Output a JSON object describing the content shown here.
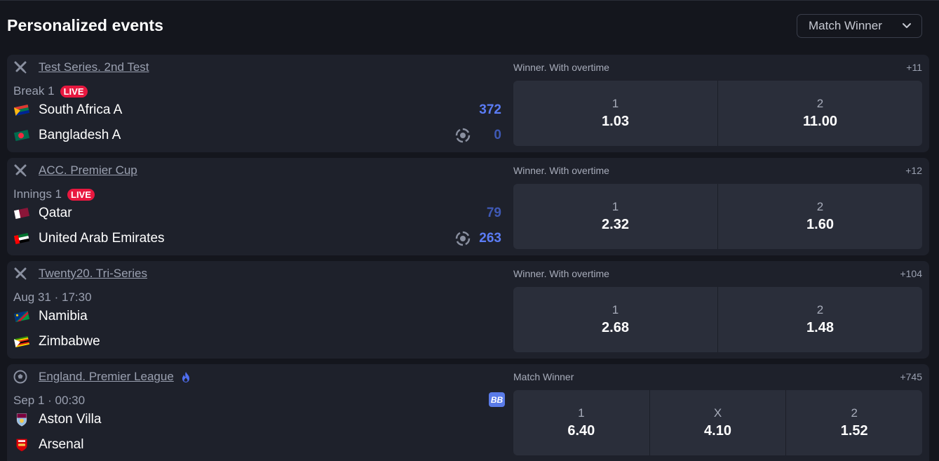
{
  "header": {
    "title": "Personalized events",
    "market_select": "Match Winner"
  },
  "events": [
    {
      "league": "Test Series. 2nd Test",
      "sport_icon": "cricket-icon",
      "status": "Break 1",
      "live": "LIVE",
      "team1": "South Africa A",
      "team2": "Bangladesh A",
      "score1": "372",
      "score2": "0",
      "market": "Winner. With overtime",
      "more": "+11",
      "odds": [
        {
          "label": "1",
          "value": "1.03"
        },
        {
          "label": "2",
          "value": "11.00"
        }
      ]
    },
    {
      "league": "ACC. Premier Cup",
      "sport_icon": "cricket-icon",
      "status": "Innings 1",
      "live": "LIVE",
      "team1": "Qatar",
      "team2": "United Arab Emirates",
      "score1": "79",
      "score2": "263",
      "market": "Winner. With overtime",
      "more": "+12",
      "odds": [
        {
          "label": "1",
          "value": "2.32"
        },
        {
          "label": "2",
          "value": "1.60"
        }
      ]
    },
    {
      "league": "Twenty20. Tri-Series",
      "sport_icon": "cricket-icon",
      "status": "Aug 31 · 17:30",
      "team1": "Namibia",
      "team2": "Zimbabwe",
      "market": "Winner. With overtime",
      "more": "+104",
      "odds": [
        {
          "label": "1",
          "value": "2.68"
        },
        {
          "label": "2",
          "value": "1.48"
        }
      ]
    },
    {
      "league": "England. Premier League",
      "sport_icon": "football-icon",
      "status": "Sep 1 · 00:30",
      "bb": "BB",
      "team1": "Aston Villa",
      "team2": "Arsenal",
      "market": "Match Winner",
      "more": "+745",
      "odds": [
        {
          "label": "1",
          "value": "6.40"
        },
        {
          "label": "X",
          "value": "4.10"
        },
        {
          "label": "2",
          "value": "1.52"
        }
      ]
    }
  ],
  "colors": {
    "background": "#14161d",
    "card": "#1e212b",
    "odds_cell": "#2a2e3a",
    "live_badge": "#e8183f",
    "score_accent": "#5b7cf5"
  }
}
